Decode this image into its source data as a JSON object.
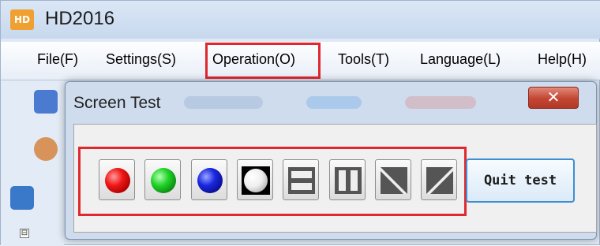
{
  "app": {
    "logo_text": "HD",
    "title": "HD2016"
  },
  "menu": {
    "file": "File(F)",
    "settings": "Settings(S)",
    "operation": "Operation(O)",
    "tools": "Tools(T)",
    "language": "Language(L)",
    "help": "Help(H)"
  },
  "tree": {
    "expander": "⊟"
  },
  "dialog": {
    "title": "Screen Test",
    "close_glyph": "✕",
    "buttons": [
      {
        "name": "red-test-button",
        "icon": "red-circle-icon",
        "color": "#e8141c"
      },
      {
        "name": "green-test-button",
        "icon": "green-circle-icon",
        "color": "#22c02a"
      },
      {
        "name": "blue-test-button",
        "icon": "blue-circle-icon",
        "color": "#1a26d8"
      },
      {
        "name": "white-test-button",
        "icon": "white-circle-icon",
        "color": "#ffffff"
      },
      {
        "name": "horizontal-lines-test-button",
        "icon": "horizontal-bars-icon"
      },
      {
        "name": "vertical-lines-test-button",
        "icon": "vertical-bars-icon"
      },
      {
        "name": "diagonal-scan-test-button",
        "icon": "diagonal-down-icon"
      },
      {
        "name": "diagonal-reverse-test-button",
        "icon": "diagonal-up-icon"
      }
    ],
    "quit_label": "Quit test"
  },
  "colors": {
    "highlight": "#e0282f",
    "quit_border": "#3d8fd1"
  }
}
